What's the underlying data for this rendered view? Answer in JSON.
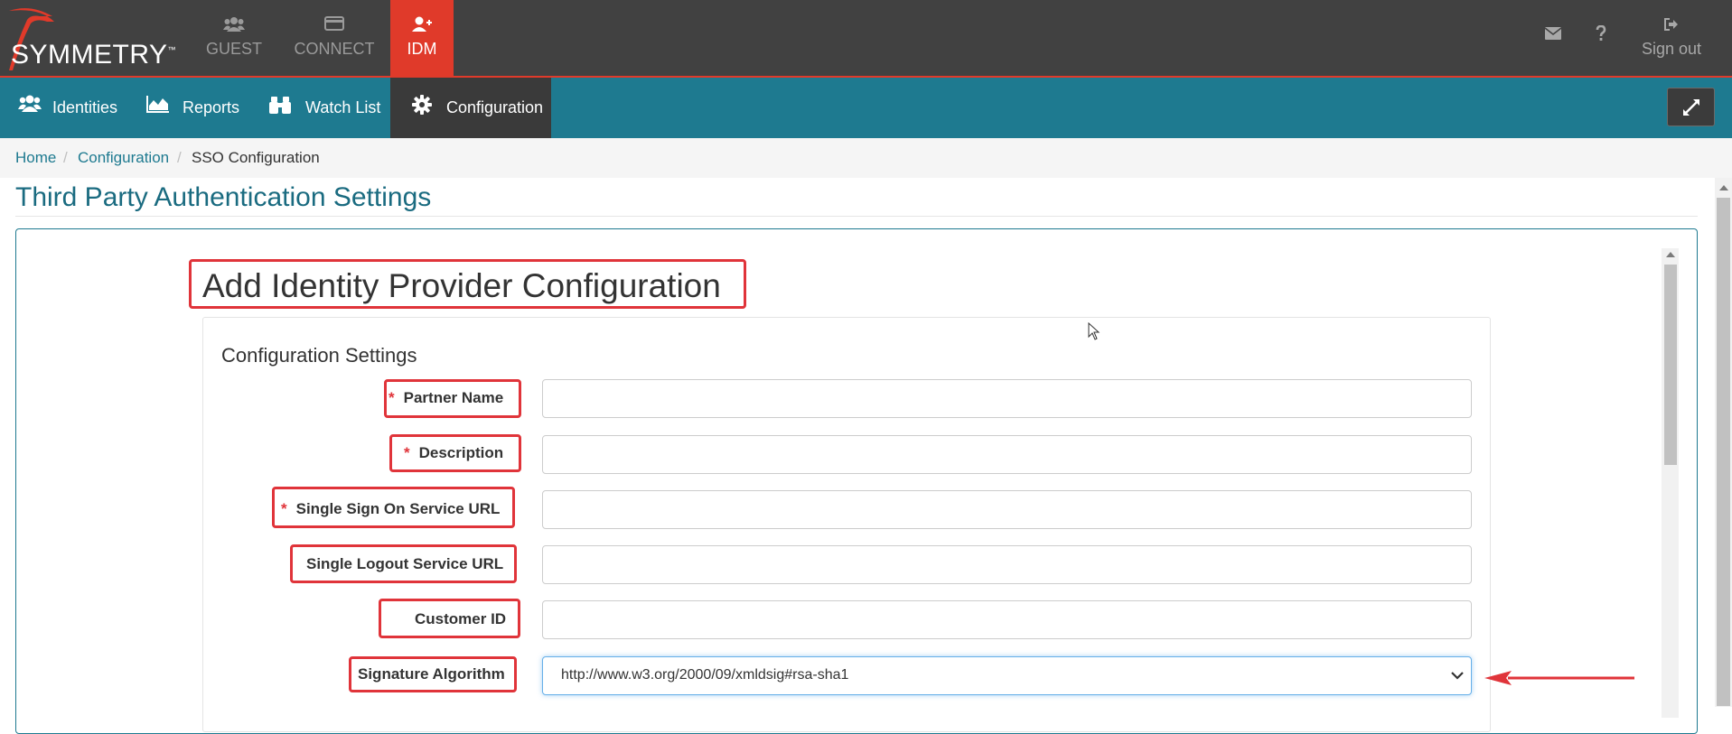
{
  "brand": {
    "name": "SYMMETRY",
    "trademark": "™"
  },
  "top_nav": {
    "items": [
      {
        "label": "GUEST",
        "icon": "users-icon"
      },
      {
        "label": "CONNECT",
        "icon": "card-icon"
      },
      {
        "label": "IDM",
        "icon": "user-plus-icon",
        "active": true
      }
    ],
    "mail_icon": "envelope-icon",
    "help_icon": "question-icon",
    "sign_out": "Sign out"
  },
  "sub_nav": {
    "items": [
      {
        "label": "Identities",
        "icon": "users-icon"
      },
      {
        "label": "Reports",
        "icon": "area-chart-icon"
      },
      {
        "label": "Watch List",
        "icon": "binoculars-icon"
      },
      {
        "label": "Configuration",
        "icon": "gear-icon",
        "active": true
      }
    ],
    "expand_icon": "expand-icon"
  },
  "breadcrumb": {
    "home": "Home",
    "configuration": "Configuration",
    "current": "SSO Configuration",
    "separator": "/"
  },
  "page": {
    "title": "Third Party Authentication Settings",
    "section_heading": "Add Identity Provider Configuration",
    "card_title": "Configuration Settings"
  },
  "form": {
    "required_marker": "*",
    "fields": [
      {
        "label": "Partner Name",
        "required": true,
        "value": ""
      },
      {
        "label": "Description",
        "required": true,
        "value": ""
      },
      {
        "label": "Single Sign On Service URL",
        "required": true,
        "value": ""
      },
      {
        "label": "Single Logout Service URL",
        "required": false,
        "value": ""
      },
      {
        "label": "Customer ID",
        "required": false,
        "value": ""
      }
    ],
    "signature_algorithm": {
      "label": "Signature Algorithm",
      "value": "http://www.w3.org/2000/09/xmldsig#rsa-sha1"
    }
  },
  "colors": {
    "topbar": "#414141",
    "accent_red": "#e03a2a",
    "subnav_teal": "#1e7a90",
    "highlight_red": "#e0343a"
  }
}
